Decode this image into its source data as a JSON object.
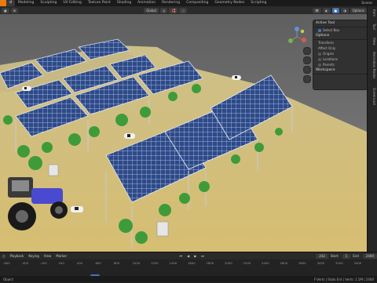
{
  "topbar": {
    "workspaces": [
      "d",
      "Modeling",
      "Sculpting",
      "UV Editing",
      "Texture Paint",
      "Shading",
      "Animation",
      "Rendering",
      "Compositing",
      "Geometry Nodes",
      "Scripting"
    ],
    "active_index": 0,
    "scene_label": "Scene"
  },
  "header": {
    "orientation": "Global",
    "options_label": "Options"
  },
  "npanel": {
    "active_tool_title": "Active Tool",
    "tool_name": "Select Box",
    "options_title": "Options",
    "transform_title": "Transform",
    "affect_only_label": "Affect Only",
    "origins_label": "Origins",
    "locations_label": "Locations",
    "parents_label": "Parents",
    "workspace_title": "Workspace"
  },
  "sidebar_tabs": [
    "Item",
    "Tool",
    "View",
    "Animation Nodes",
    "Screencast"
  ],
  "timeline": {
    "playback_label": "Playback",
    "keying_label": "Keying",
    "view_label": "View",
    "marker_label": "Marker",
    "current_frame": "242",
    "start_label": "Start",
    "start_value": "1",
    "end_label": "End",
    "end_value": "2400",
    "ruler": [
      "-800",
      "-400",
      "-200",
      "200",
      "400",
      "600",
      "800",
      "1000",
      "1200",
      "1400",
      "1600",
      "1800",
      "2000",
      "2200",
      "2400",
      "2600",
      "2800",
      "3000",
      "3200",
      "3400"
    ],
    "playhead_label": "242"
  },
  "status": {
    "left": "Object",
    "right": "F-Verts | Stats Ent | Verts: 1.5M | 2400"
  },
  "colors": {
    "accent": "#4772b3",
    "ground": "#d2bd73",
    "sky": "#6c6c6c",
    "tractor": "#4a4ad0"
  }
}
